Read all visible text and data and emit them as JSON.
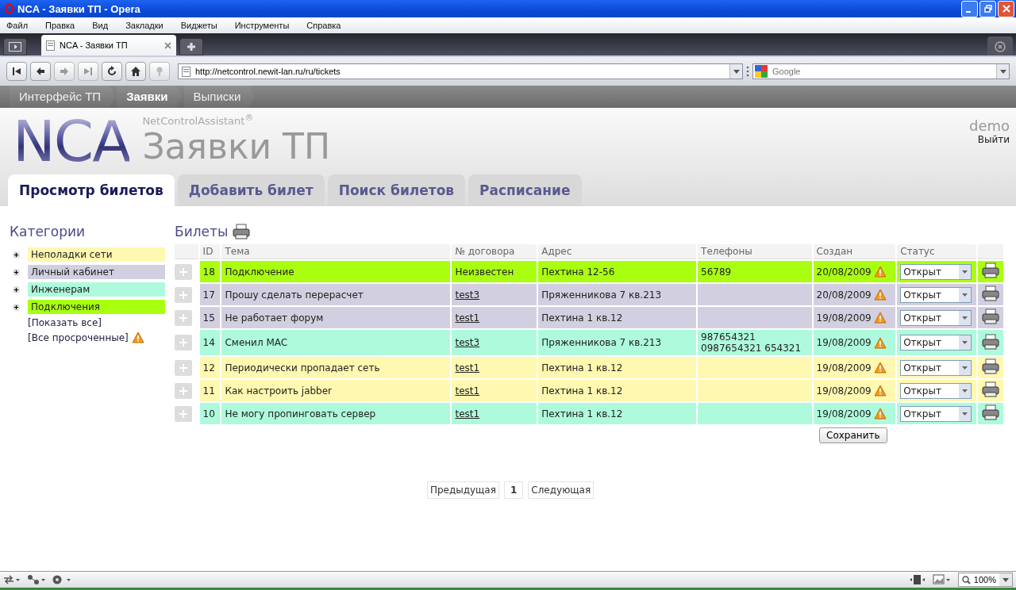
{
  "window": {
    "title": "NCA - Заявки ТП - Opera"
  },
  "menu": [
    "Файл",
    "Правка",
    "Вид",
    "Закладки",
    "Виджеты",
    "Инструменты",
    "Справка"
  ],
  "browser_tabs": [
    {
      "label": "NCA - Заявки ТП",
      "selected": true
    }
  ],
  "address_bar": {
    "url": "http://netcontrol.newit-lan.ru/ru/tickets"
  },
  "search": {
    "placeholder": "Google"
  },
  "breadcrumbs": [
    {
      "label": "Интерфейс ТП",
      "selected": false
    },
    {
      "label": "Заявки",
      "selected": true
    },
    {
      "label": "Выписки",
      "selected": false
    }
  ],
  "header": {
    "logo": "NCA",
    "subtitle": "NetControlAssistant$^{®}$",
    "title": "Заявки ТП",
    "user": "demo",
    "logout": "Выйти"
  },
  "page_tabs": [
    {
      "label": "Просмотр билетов",
      "selected": true
    },
    {
      "label": "Добавить билет",
      "selected": false
    },
    {
      "label": "Поиск билетов",
      "selected": false
    },
    {
      "label": "Расписание",
      "selected": false
    }
  ],
  "sidebar": {
    "title": "Категории",
    "categories": [
      {
        "label": "Неполадки сети",
        "color": "#fff8b0"
      },
      {
        "label": "Личный кабинет",
        "color": "#d2d0e0"
      },
      {
        "label": "Инженерам",
        "color": "#aefadc"
      },
      {
        "label": "Подключения",
        "color": "#aaff10"
      }
    ],
    "links": [
      {
        "label": "[Показать все]",
        "warning": false
      },
      {
        "label": "[Все просроченные]",
        "warning": true
      }
    ]
  },
  "tickets": {
    "title": "Билеты",
    "columns": [
      "ID",
      "Тема",
      "№ договора",
      "Адрес",
      "Телефоны",
      "Создан",
      "Статус"
    ],
    "rows": [
      {
        "id": "18",
        "topic": "Подключение",
        "contract": "Неизвестен",
        "linked": false,
        "address": "Пехтина 12-56",
        "phones": [
          "56789"
        ],
        "created": "20/08/2009",
        "overdue": true,
        "status": "Открыт",
        "color": "#aaff10"
      },
      {
        "id": "17",
        "topic": "Прошу сделать перерасчет",
        "contract": "test3",
        "linked": true,
        "address": "Пряженникова 7 кв.213",
        "phones": [],
        "created": "20/08/2009",
        "overdue": true,
        "status": "Открыт",
        "color": "#d2d0e0"
      },
      {
        "id": "15",
        "topic": "Не работает форум",
        "contract": "test1",
        "linked": true,
        "address": "Пехтина 1 кв.12",
        "phones": [],
        "created": "19/08/2009",
        "overdue": true,
        "status": "Открыт",
        "color": "#d2d0e0"
      },
      {
        "id": "14",
        "topic": "Сменил MAC",
        "contract": "test3",
        "linked": true,
        "address": "Пряженникова 7 кв.213",
        "phones": [
          "987654321",
          "0987654321 654321"
        ],
        "created": "19/08/2009",
        "overdue": true,
        "status": "Открыт",
        "color": "#aefadc"
      },
      {
        "id": "12",
        "topic": "Периодически пропадает сеть",
        "contract": "test1",
        "linked": true,
        "address": "Пехтина 1 кв.12",
        "phones": [],
        "created": "19/08/2009",
        "overdue": true,
        "status": "Открыт",
        "color": "#fff8b0"
      },
      {
        "id": "11",
        "topic": "Как настроить jabber",
        "contract": "test1",
        "linked": true,
        "address": "Пехтина 1 кв.12",
        "phones": [],
        "created": "19/08/2009",
        "overdue": true,
        "status": "Открыт",
        "color": "#fff8b0"
      },
      {
        "id": "10",
        "topic": "Не могу пропинговать сервер",
        "contract": "test1",
        "linked": true,
        "address": "Пехтина 1 кв.12",
        "phones": [],
        "created": "19/08/2009",
        "overdue": true,
        "status": "Открыт",
        "color": "#aefadc"
      }
    ],
    "save": "Сохранить"
  },
  "pagination": {
    "prev": "Предыдущая",
    "pages": [
      {
        "label": "1",
        "selected": true
      }
    ],
    "next": "Следующая"
  },
  "status_bar": {
    "zoom": "100%"
  }
}
